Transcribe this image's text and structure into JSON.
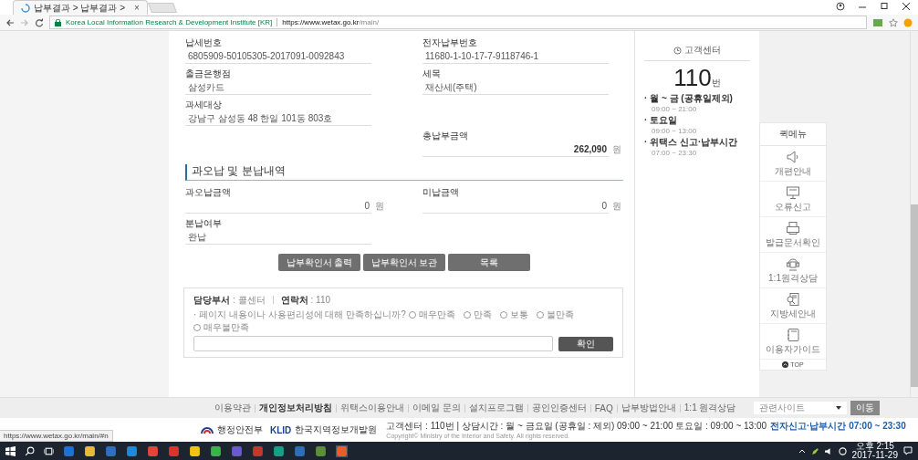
{
  "browser": {
    "tab_title": "납부결과 > 납부결과 >",
    "tab_close": "×",
    "site_name": "Korea Local Information Research & Development Institute [KR]",
    "url_host": "https://www.wetax.go.kr",
    "url_path": "/main/"
  },
  "fields": [
    {
      "left": {
        "label": "납세번호",
        "value": "6805909-50105305-2017091-0092843",
        "emphasized": false
      },
      "right": {
        "label": "전자납부번호",
        "value": "11680-1-10-17-7-9118746-1",
        "emphasized": false
      }
    },
    {
      "left": {
        "label": "출금은행점",
        "value": "삼성카드",
        "emphasized": false
      },
      "right": {
        "label": "세목",
        "value": "재산세(주택)",
        "emphasized": false
      }
    },
    {
      "left": {
        "label": "과세대상",
        "value": "강남구 삼성동 48 한일 101동 803호",
        "emphasized": false
      }
    },
    {
      "right": {
        "label": "총납부금액",
        "value": "262,090",
        "unit": "원",
        "emphasized": true
      }
    }
  ],
  "section_title": "과오납 및 분납내역",
  "section_fields": [
    {
      "left": {
        "label": "과오납금액",
        "value": "0",
        "unit": "원",
        "emphasized": false
      },
      "right": {
        "label": "미납금액",
        "value": "0",
        "unit": "원",
        "emphasized": false
      }
    },
    {
      "left": {
        "label": "분납여부",
        "value": "완납",
        "emphasized": false
      }
    }
  ],
  "buttons": [
    "납부확인서 출력",
    "납부확인서 보관",
    "목록"
  ],
  "survey": {
    "dept_label": "담당부서",
    "dept": ": 콜센터",
    "contact_label": "연락처",
    "contact": ": 110",
    "question": "· 페이지 내용이나 사용편리성에 대해 만족하십니까?",
    "options": [
      {
        "label": "매우만족",
        "selected": false
      },
      {
        "label": "만족",
        "selected": false
      },
      {
        "label": "보통",
        "selected": false
      },
      {
        "label": "불만족",
        "selected": false
      },
      {
        "label": "매우불만족",
        "selected": false
      }
    ],
    "confirm": "확인"
  },
  "customer_center": {
    "title": "고객센터",
    "number": "110",
    "unit": "번",
    "schedule": [
      {
        "label": "· 월 ~ 금 (공휴일제외)",
        "time": "09:00 ~ 21:00"
      },
      {
        "label": "· 토요일",
        "time": "09:00 ~ 13:00"
      },
      {
        "label": "· 위택스 신고·납부시간",
        "time": "07:00 ~ 23:30"
      }
    ]
  },
  "quick_menu": {
    "title": "퀵메뉴",
    "items": [
      {
        "kind": "speaker",
        "label": "개편안내"
      },
      {
        "kind": "monitor",
        "label": "오류신고"
      },
      {
        "kind": "printer",
        "label": "발급문서확인"
      },
      {
        "kind": "headset",
        "label": "1:1원격상담"
      },
      {
        "kind": "document",
        "label": "지방세안내"
      },
      {
        "kind": "notebook",
        "label": "이용자가이드"
      }
    ],
    "top": "TOP"
  },
  "footer": {
    "links": [
      {
        "label": "이용약관",
        "emphasized": false
      },
      {
        "label": "개인정보처리방침",
        "emphasized": true
      },
      {
        "label": "위택스이용안내",
        "emphasized": false
      },
      {
        "label": "이메일 문의",
        "emphasized": false
      },
      {
        "label": "설치프로그램",
        "emphasized": false
      },
      {
        "label": "공인인증센터",
        "emphasized": false
      },
      {
        "label": "FAQ",
        "emphasized": false
      },
      {
        "label": "납부방법안내",
        "emphasized": false
      },
      {
        "label": "1:1 원격상담",
        "emphasized": false
      }
    ],
    "related_site": "관련사이트",
    "go": "이동",
    "ministry": "행정안전부",
    "klid": "KLID",
    "klid_name": "한국지역정보개발원",
    "info": "고객센터 : 110번 | 상담시간 : 월 ~ 금요일 (공휴일 : 제외) 09:00 ~ 21:00 토요일 : 09:00 ~ 13:00",
    "info_highlight": "전자신고·납부시간 07:00 ~ 23:30",
    "copyright": "Copyright© Ministry of the Interior and Safety. All rights reserved."
  },
  "status_url": "https://www.wetax.go.kr/main/#n",
  "taskbar": {
    "time": "오후 2:15",
    "date": "2017-11-29"
  }
}
